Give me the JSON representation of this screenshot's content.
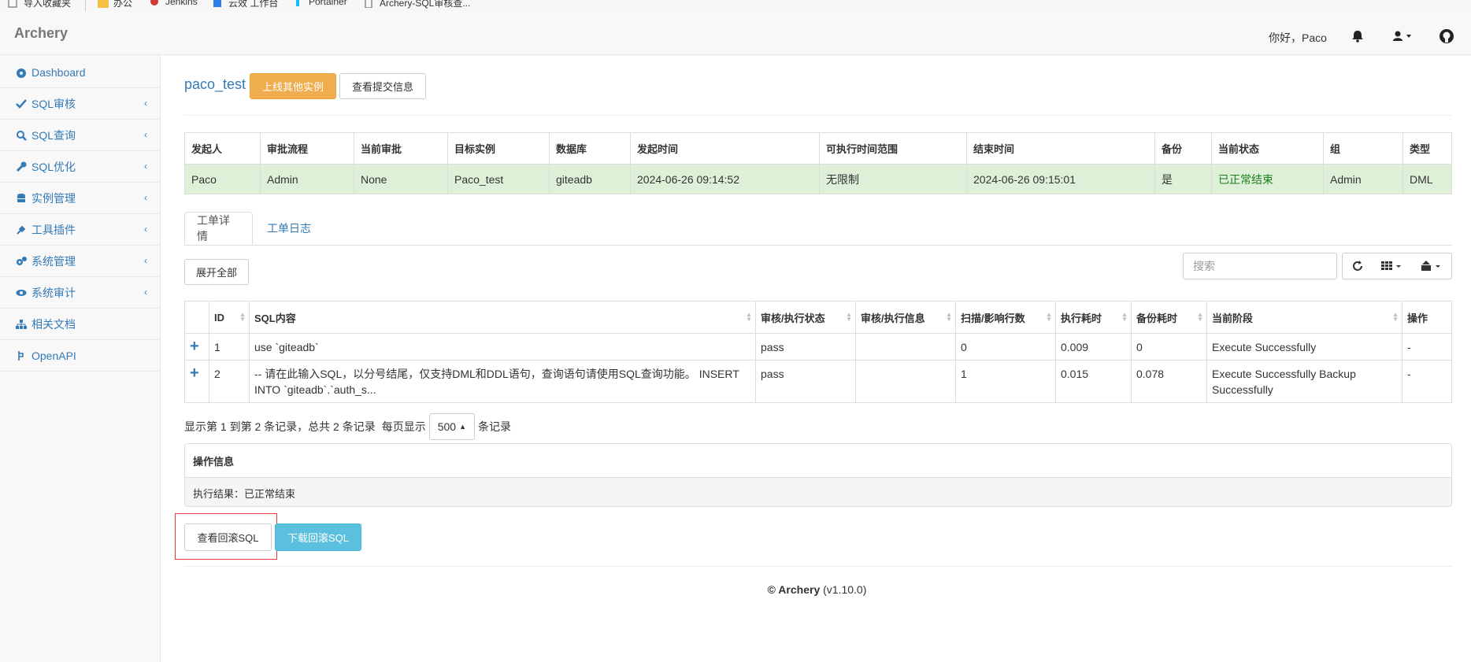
{
  "bookmarks": {
    "items": [
      {
        "label": "导入收藏夹",
        "icon": "import-icon"
      },
      {
        "label": "办公",
        "icon": "folder-icon"
      },
      {
        "label": "Jenkins",
        "icon": "jenkins-icon"
      },
      {
        "label": "云效 工作台",
        "icon": "cloud-icon"
      },
      {
        "label": "Portainer",
        "icon": "portainer-icon"
      },
      {
        "label": "Archery-SQL审核查...",
        "icon": "page-icon"
      }
    ]
  },
  "navbar": {
    "brand": "Archery",
    "greeting": "你好，Paco",
    "icons": [
      "bell-icon",
      "user-icon",
      "github-icon"
    ]
  },
  "sidebar": {
    "items": [
      {
        "label": "Dashboard",
        "icon": "dashboard-icon",
        "has_submenu": false
      },
      {
        "label": "SQL审核",
        "icon": "check-icon",
        "has_submenu": true
      },
      {
        "label": "SQL查询",
        "icon": "search-icon",
        "has_submenu": true
      },
      {
        "label": "SQL优化",
        "icon": "wrench-icon",
        "has_submenu": true
      },
      {
        "label": "实例管理",
        "icon": "database-icon",
        "has_submenu": true
      },
      {
        "label": "工具插件",
        "icon": "plug-icon",
        "has_submenu": true
      },
      {
        "label": "系统管理",
        "icon": "cogs-icon",
        "has_submenu": true
      },
      {
        "label": "系统审计",
        "icon": "eye-icon",
        "has_submenu": true
      },
      {
        "label": "相关文档",
        "icon": "sitemap-icon",
        "has_submenu": false
      },
      {
        "label": "OpenAPI",
        "icon": "api-icon",
        "has_submenu": false
      }
    ]
  },
  "header": {
    "title": "paco_test",
    "online_other_button": "上线其他实例",
    "view_submit_button": "查看提交信息"
  },
  "info_table": {
    "columns": [
      "发起人",
      "审批流程",
      "当前审批",
      "目标实例",
      "数据库",
      "发起时间",
      "可执行时间范围",
      "结束时间",
      "备份",
      "当前状态",
      "组",
      "类型"
    ],
    "row": [
      "Paco",
      "Admin",
      "None",
      "Paco_test",
      "giteadb",
      "2024-06-26 09:14:52",
      "无限制",
      "2024-06-26 09:15:01",
      "是",
      "已正常结束",
      "Admin",
      "DML"
    ]
  },
  "tabs": [
    {
      "label": "工单详情",
      "active": true
    },
    {
      "label": "工单日志",
      "active": false
    }
  ],
  "toolbar": {
    "expand_all": "展开全部",
    "search_placeholder": "搜索",
    "icons": [
      "refresh-icon",
      "columns-icon",
      "export-icon"
    ]
  },
  "detail_table": {
    "columns": [
      "ID",
      "SQL内容",
      "审核/执行状态",
      "审核/执行信息",
      "扫描/影响行数",
      "执行耗时",
      "备份耗时",
      "当前阶段",
      "操作"
    ],
    "rows": [
      {
        "id": "1",
        "sql": "use `giteadb`",
        "status": "pass",
        "info": "",
        "rows": "0",
        "exec_time": "0.009",
        "backup_time": "0",
        "stage": "Execute Successfully",
        "op": "-"
      },
      {
        "id": "2",
        "sql": "-- 请在此输入SQL，以分号结尾，仅支持DML和DDL语句，查询语句请使用SQL查询功能。 INSERT INTO `giteadb`.`auth_s...",
        "status": "pass",
        "info": "",
        "rows": "1",
        "exec_time": "0.015",
        "backup_time": "0.078",
        "stage": "Execute Successfully Backup Successfully",
        "op": "-"
      }
    ]
  },
  "pagination": {
    "summary": "显示第 1 到第 2 条记录，总共 2 条记录",
    "per_page_prefix": "每页显示",
    "page_size": "500",
    "per_page_suffix": "条记录"
  },
  "operation_panel": {
    "title": "操作信息",
    "result": "执行结果：已正常结束"
  },
  "actions": {
    "view_rollback": "查看回滚SQL",
    "download_rollback": "下载回滚SQL"
  },
  "footer": {
    "copyright": "© Archery",
    "version": "(v1.10.0)"
  },
  "colors": {
    "link": "#337ab7",
    "warning": "#f0ad4e",
    "info": "#5bc0de",
    "success_row": "#dff0d8",
    "highlight_box": "#e03a3a"
  }
}
